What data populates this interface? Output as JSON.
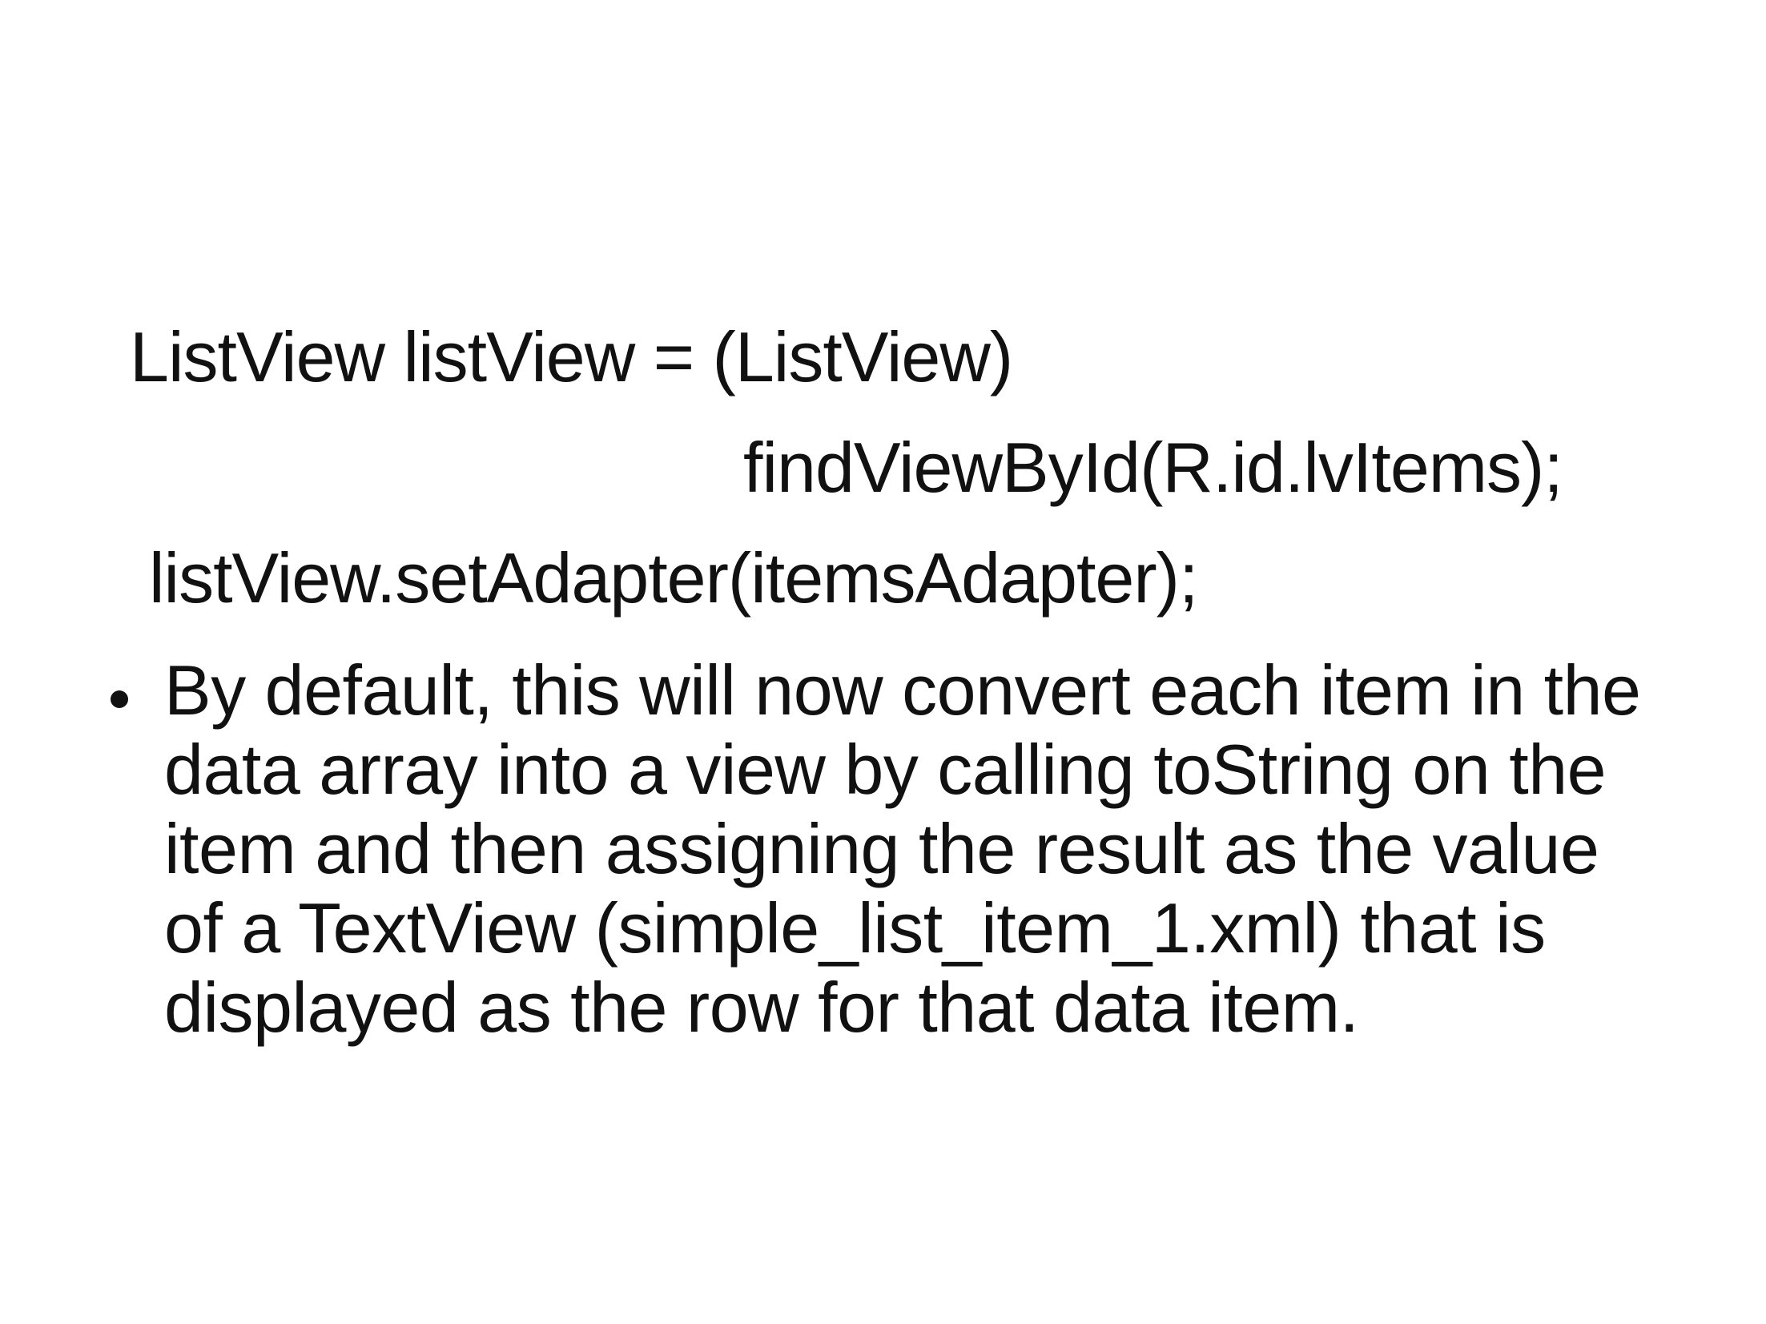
{
  "slide": {
    "code_lines": [
      "ListView listView = (ListView)",
      "findViewById(R.id.lvItems);",
      "listView.setAdapter(itemsAdapter);"
    ],
    "bullets": [
      {
        "lines": [
          "By default, this will now convert each item in the",
          "data array into a view by calling toString on the",
          "item and then assigning the result as the value",
          "of a TextView (simple_list_item_1.xml) that is",
          "displayed as the row for that data item."
        ]
      }
    ]
  }
}
